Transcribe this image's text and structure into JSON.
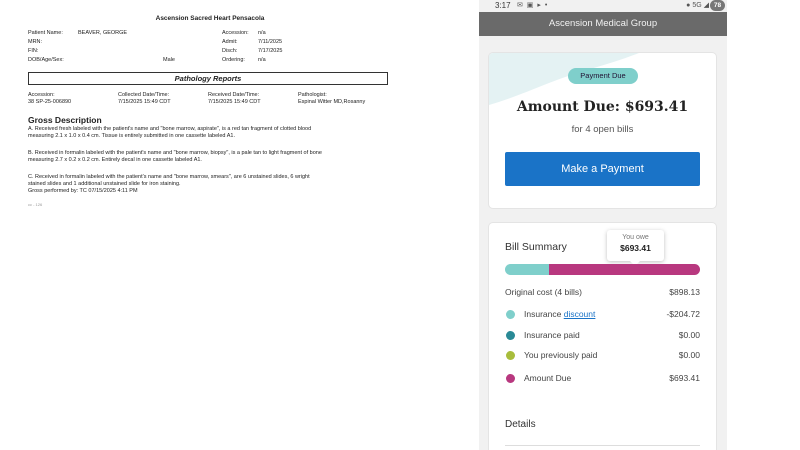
{
  "document": {
    "hospital": "Ascension Sacred Heart Pensacola",
    "patient": {
      "name_label": "Patient Name:",
      "name_value": "BEAVER, GEORGE",
      "mrn_label": "MRN:",
      "fin_label": "FIN:",
      "dob_label": "DOB/Age/Sex:",
      "sex": "Male"
    },
    "encounter": {
      "accession_label": "Accession:",
      "accession_value": "n/a",
      "admit_label": "Admit:",
      "admit_value": "7/11/2025",
      "disch_label": "Disch:",
      "disch_value": "7/17/2025",
      "ordering_label": "Ordering:",
      "ordering_value": "n/a"
    },
    "section_title": "Pathology Reports",
    "columns": {
      "accession_head": "Accession:",
      "accession_val": "38 SP-25-006890",
      "collected_head": "Collected Date/Time:",
      "collected_val": "7/15/2025 15:49 CDT",
      "received_head": "Received Date/Time:",
      "received_val": "7/15/2025 15:49 CDT",
      "pathologist_head": "Pathologist:",
      "pathologist_val": "Espinal Witter MD,Rosanny"
    },
    "gross_title": "Gross Description",
    "paragraph_a_1": "A. Received fresh labeled with the patient's name and \"bone marrow, aspirate\", is a red tan fragment of clotted blood",
    "paragraph_a_2": "measuring 2.1 x 1.0 x 0.4 cm.  Tissue is entirely submitted in one cassette labeled A1.",
    "paragraph_b_1": "B. Received in formalin labeled with the patient's name and \"bone marrow, biopsy\", is a pale tan to light fragment of bone",
    "paragraph_b_2": "measuring 2.7 x 0.2 x 0.2 cm.  Entirely decal in one cassette labeled A1.",
    "paragraph_c_1": "C. Received in formalin labeled with the patient's name and \"bone marrow, smears\", are 6 unstained slides, 6 wright",
    "paragraph_c_2": "stained slides and 1 additional unstained slide for iron staining.",
    "paragraph_c_3": "Gross performed by: TC 07/15/2025 4:11 PM",
    "footnote": "cc - 126"
  },
  "phone": {
    "status": {
      "time": "3:17",
      "icons": "✉ ▣ ▸ •",
      "right": "● 5G ◢",
      "battery": "78"
    },
    "app_title": "Ascension Medical Group",
    "payment_card": {
      "badge": "Payment Due",
      "amount_due": "Amount Due: $693.41",
      "subtitle": "for 4 open bills",
      "button": "Make a Payment"
    },
    "summary": {
      "title": "Bill Summary",
      "tooltip_label": "You owe",
      "tooltip_value": "$693.41",
      "bar": {
        "insurance_fraction": 0.227,
        "due_fraction": 0.773
      },
      "original_label": "Original cost (4 bills)",
      "original_value": "$898.13",
      "insurance_label": "Insurance",
      "insurance_link": "discount",
      "insurance_value": "-$204.72",
      "paid_label": "Insurance paid",
      "paid_value": "$0.00",
      "prev_label": "You previously paid",
      "prev_value": "$0.00",
      "due_label": "Amount Due",
      "due_value": "$693.41",
      "details": "Details"
    },
    "colors": {
      "teal": "#7fcfcb",
      "dark_teal": "#2a8a96",
      "olive": "#a8bd3c",
      "magenta": "#b8387f",
      "blue": "#1a73c7"
    }
  }
}
